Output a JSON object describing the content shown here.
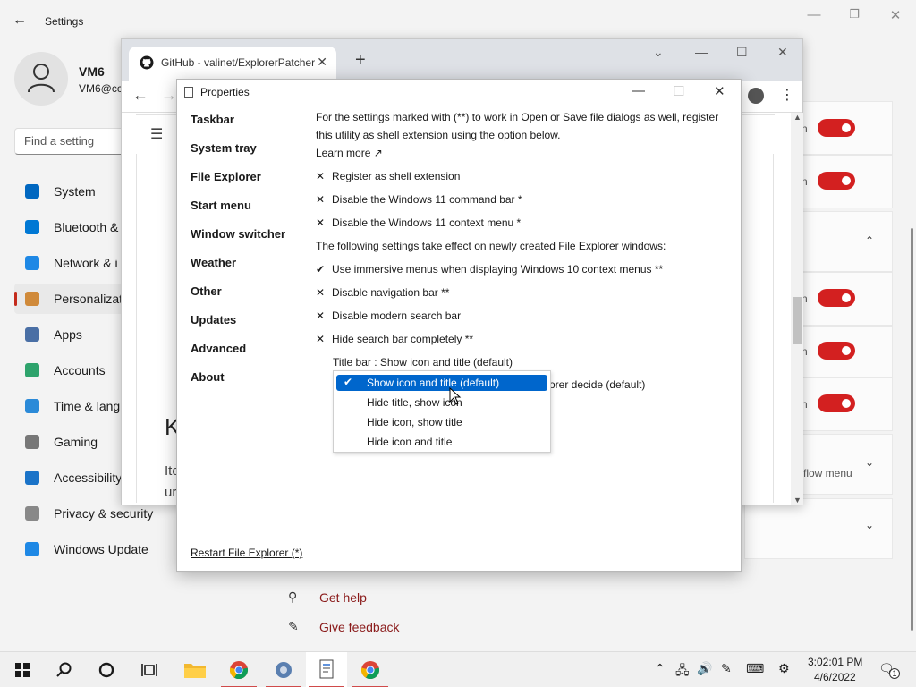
{
  "settings": {
    "title": "Settings",
    "user_name": "VM6",
    "user_email": "VM6@cc",
    "search_placeholder": "Find a setting",
    "nav": [
      {
        "label": "System",
        "icon": "monitor-icon",
        "color": "#0067c0"
      },
      {
        "label": "Bluetooth &",
        "icon": "bluetooth-icon",
        "color": "#0078d4"
      },
      {
        "label": "Network & i",
        "icon": "wifi-icon",
        "color": "#1e88e5"
      },
      {
        "label": "Personalizat",
        "icon": "brush-icon",
        "color": "#d08a3a"
      },
      {
        "label": "Apps",
        "icon": "apps-icon",
        "color": "#4a6fa5"
      },
      {
        "label": "Accounts",
        "icon": "person-icon",
        "color": "#2ea36c"
      },
      {
        "label": "Time & lang",
        "icon": "clock-globe-icon",
        "color": "#2b8ad8"
      },
      {
        "label": "Gaming",
        "icon": "gamepad-icon",
        "color": "#777777"
      },
      {
        "label": "Accessibility",
        "icon": "accessibility-icon",
        "color": "#1a73c8"
      },
      {
        "label": "Privacy & security",
        "icon": "shield-icon",
        "color": "#888888"
      },
      {
        "label": "Windows Update",
        "icon": "update-icon",
        "color": "#1e88e5"
      }
    ],
    "active_index": 3,
    "right_letters": [
      "n",
      "n",
      "n",
      "n",
      "n"
    ],
    "flow_menu_text": "flow menu",
    "get_help": "Get help",
    "give_feedback": "Give feedback"
  },
  "chrome": {
    "tab_title": "GitHub - valinet/ExplorerPatcher",
    "page_k": "K",
    "page_it": "Ite",
    "page_ur": "ur"
  },
  "props": {
    "title": "Properties",
    "sections": [
      "Taskbar",
      "System tray",
      "File Explorer",
      "Start menu",
      "Window switcher",
      "Weather",
      "Other",
      "Updates",
      "Advanced",
      "About"
    ],
    "current_section": "File Explorer",
    "intro_line1": "For the settings marked with (**) to work in Open or Save file dialogs as well, register",
    "intro_line2": "this utility as shell extension using the option below.",
    "learn_more": "Learn more ↗",
    "options_a": [
      {
        "mark": "✕",
        "text": "Register as shell extension"
      },
      {
        "mark": "✕",
        "text": "Disable the Windows 11 command bar *"
      },
      {
        "mark": "✕",
        "text": "Disable the Windows 11 context menu *"
      }
    ],
    "note": "The following settings take effect on newly created File Explorer windows:",
    "options_b": [
      {
        "mark": "✔",
        "text": "Use immersive menus when displaying Windows 10 context menus **"
      },
      {
        "mark": "✕",
        "text": "Disable navigation bar **"
      },
      {
        "mark": "✕",
        "text": "Disable modern search bar"
      },
      {
        "mark": "✕",
        "text": "Hide search bar completely **"
      }
    ],
    "title_bar_label": "Title bar : Show icon and title (default)",
    "behind_text": "orer decide (default)",
    "dropdown": [
      "Show icon and title (default)",
      "Hide title, show icon",
      "Hide icon, show title",
      "Hide icon and title"
    ],
    "dropdown_selected": 0,
    "restart": "Restart File Explorer (*)"
  },
  "taskbar": {
    "time": "3:02:01 PM",
    "date": "4/6/2022",
    "notification_count": "1"
  }
}
